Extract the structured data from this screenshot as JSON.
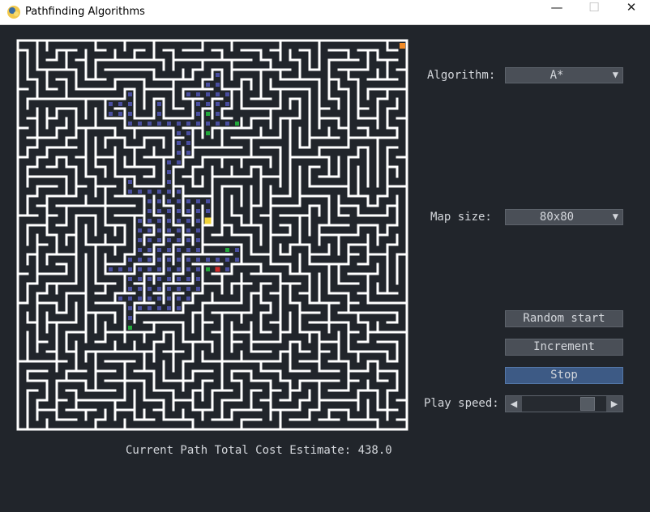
{
  "window": {
    "title": "Pathfinding Algorithms",
    "minimize_glyph": "—",
    "maximize_glyph": "☐",
    "close_glyph": "✕"
  },
  "controls": {
    "algorithm_label": "Algorithm:",
    "algorithm_value": "A*",
    "map_size_label": "Map size:",
    "map_size_value": "80x80",
    "dropdown_arrow": "▼",
    "random_start_label": "Random start",
    "increment_label": "Increment",
    "stop_label": "Stop",
    "play_speed_label": "Play speed:",
    "play_speed_level": 0.82,
    "slider_left_glyph": "◀",
    "slider_right_glyph": "▶"
  },
  "status": {
    "text": "Current Path Total Cost Estimate: 438.0"
  },
  "maze": {
    "size": "80x80",
    "colors": {
      "background": "#21252b",
      "wall": "#ffffff",
      "visited": "#4a4fa0",
      "frontier": "#22a83a",
      "start": "#f2d43a",
      "current": "#d22a2a",
      "goal": "#f28c28"
    }
  },
  "icons": {
    "app": "pygame-snake-icon",
    "dropdown": "chevron-down-icon"
  }
}
